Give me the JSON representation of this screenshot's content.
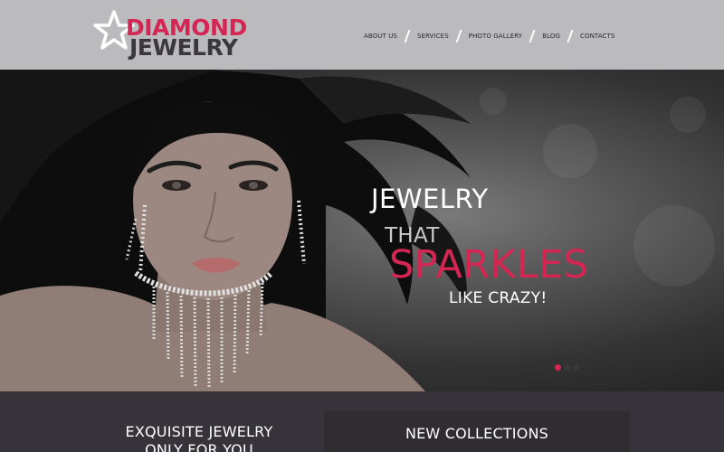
{
  "brand": {
    "line1": "DIAMOND",
    "line2": "JEWELRY",
    "accent_color": "#d42553",
    "dark_color": "#3a383c",
    "icon": "star-icon"
  },
  "nav": {
    "items": [
      {
        "label": "ABOUT US"
      },
      {
        "label": "SERVICES"
      },
      {
        "label": "PHOTO GALLERY"
      },
      {
        "label": "BLOG"
      },
      {
        "label": "CONTACTS"
      }
    ]
  },
  "hero": {
    "line1": "JEWELRY",
    "line2": "THAT",
    "line3": "SPARKLES",
    "line4": "LIKE CRAZY!",
    "slides_total": 3,
    "active_slide": 1
  },
  "sections": {
    "left_title": "EXQUISITE JEWELRY ONLY FOR YOU",
    "right_title": "NEW COLLECTIONS"
  },
  "colors": {
    "header_bg": "#bbbabd",
    "footer_bg": "#36333a",
    "accent": "#d42553"
  }
}
